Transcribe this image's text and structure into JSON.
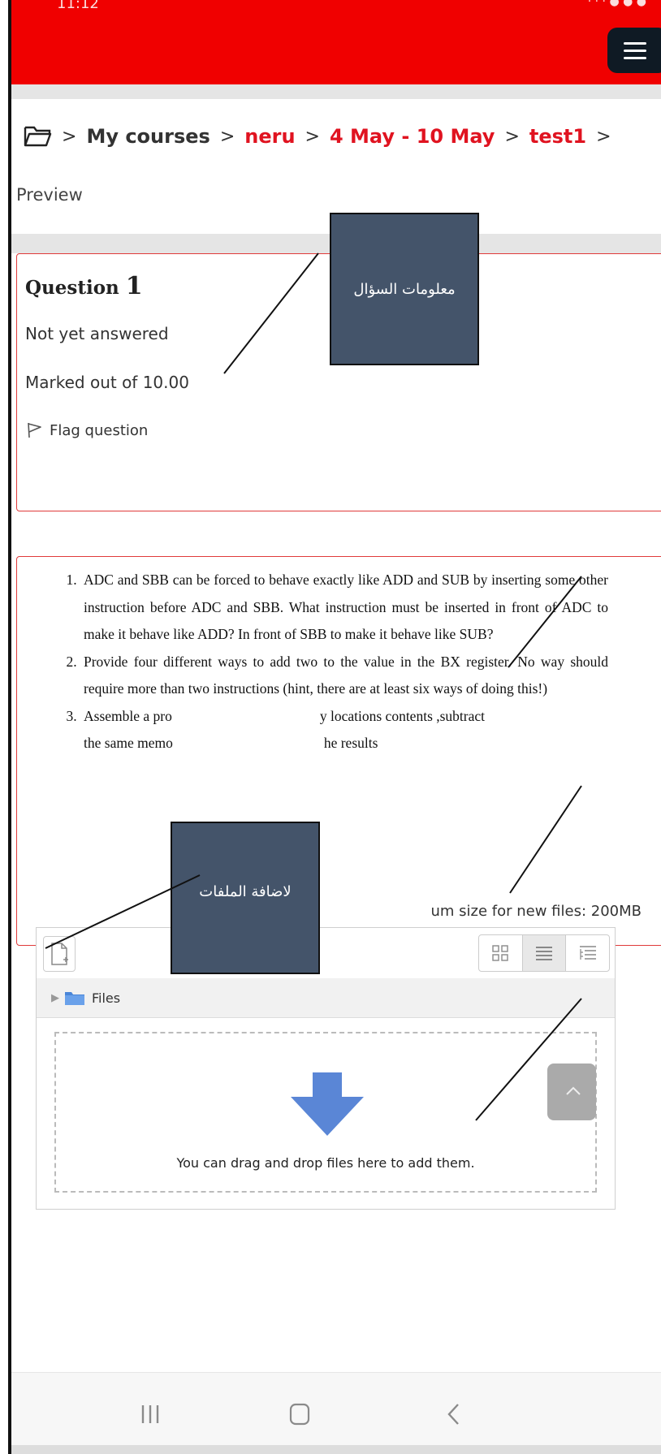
{
  "status_bar": {
    "time": "11:12",
    "indicators": "· · · ● ● ●"
  },
  "breadcrumb": {
    "items": [
      "My courses",
      "neru",
      "4 May - 10 May",
      "test1"
    ],
    "separator": ">",
    "current": "Preview"
  },
  "question_info": {
    "title_prefix": "Question",
    "number": "1",
    "state": "Not yet answered",
    "mark": "Marked out of 10.00",
    "flag_label": "Flag question"
  },
  "annotations": {
    "question_info_label": "معلومات السؤال",
    "add_files_label": "لاضافة الملفات"
  },
  "question_text": [
    "ADC and SBB can be forced to behave exactly like ADD and SUB by inserting some other instruction before ADC and SBB. What instruction must be inserted in front of ADC to make it behave like ADD? In front of SBB to make it behave like SUB?",
    "Provide four different ways to add two to the value in the BX register. No way should require more than two instructions (hint, there are at least six ways of doing this!)",
    "Assemble a pro",
    "y locations contents ,subtract",
    "the same memo",
    "he results"
  ],
  "file_picker": {
    "max_size": "um size for new files: 200MB",
    "folder_label": "Files",
    "drop_text": "You can drag and drop files here to add them."
  },
  "colors": {
    "brand_red": "#f00000",
    "annotation_box": "#44546a",
    "accent_border": "#e03a3a"
  }
}
